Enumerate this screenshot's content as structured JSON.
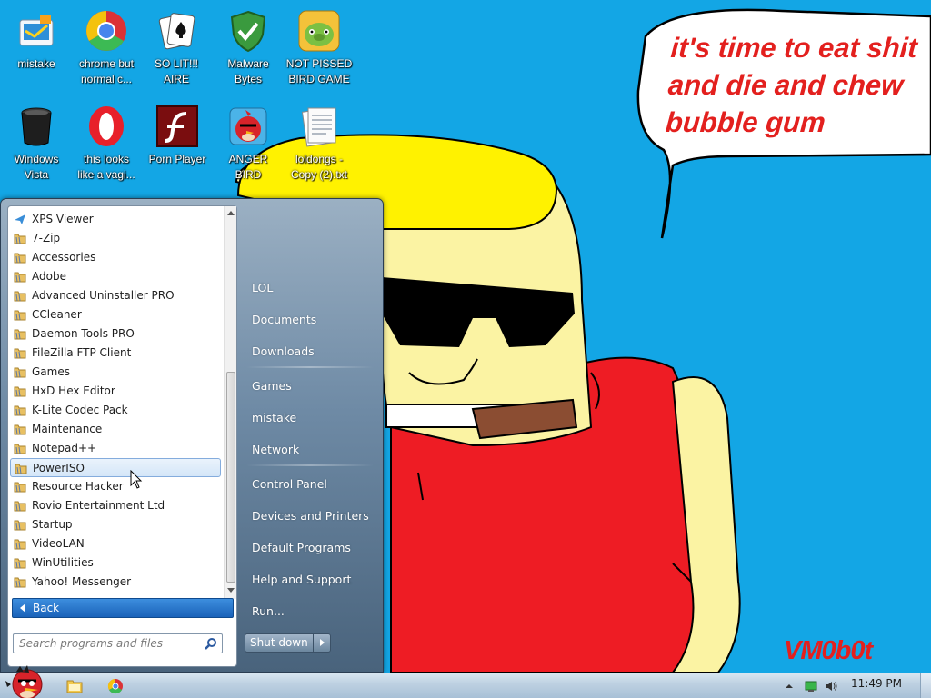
{
  "desktop": {
    "speech_bubble": "it's time to eat shit\nand die and chew\nbubble gum",
    "signature": "VM0b0t",
    "icons": [
      {
        "label": "mistake",
        "icon": "media-center-icon"
      },
      {
        "label": "chrome but\nnormal c...",
        "icon": "chrome-icon"
      },
      {
        "label": "SO LIT!!!\nAIRE",
        "icon": "solitaire-icon"
      },
      {
        "label": "Malware\nBytes",
        "icon": "malwarebytes-shield-icon"
      },
      {
        "label": "NOT PISSED\nBIRD GAME",
        "icon": "bad-piggies-icon"
      },
      {
        "label": "Windows\nVista",
        "icon": "trash-can-icon"
      },
      {
        "label": "this looks\nlike a vagi...",
        "icon": "opera-icon"
      },
      {
        "label": "Porn Player",
        "icon": "flash-player-icon"
      },
      {
        "label": "ANGER\nBIRD",
        "icon": "angry-birds-icon"
      },
      {
        "label": "loldongs -\nCopy (2).txt",
        "icon": "text-file-icon"
      }
    ]
  },
  "start_menu": {
    "programs": [
      "XPS Viewer",
      "7-Zip",
      "Accessories",
      "Adobe",
      "Advanced Uninstaller PRO",
      "CCleaner",
      "Daemon Tools PRO",
      "FileZilla FTP Client",
      "Games",
      "HxD Hex Editor",
      "K-Lite Codec Pack",
      "Maintenance",
      "Notepad++",
      "PowerISO",
      "Resource Hacker",
      "Rovio Entertainment Ltd",
      "Startup",
      "VideoLAN",
      "WinUtilities",
      "Yahoo! Messenger"
    ],
    "highlighted_program": "PowerISO",
    "back_label": "Back",
    "search_placeholder": "Search programs and files",
    "right_items": [
      "LOL",
      "Documents",
      "Downloads",
      "Games",
      "mistake",
      "Network",
      "Control Panel",
      "Devices and Printers",
      "Default Programs",
      "Help and Support",
      "Run..."
    ],
    "shutdown_label": "Shut down"
  },
  "taskbar": {
    "clock": "11:49 PM",
    "pinned": [
      "explorer-folder-icon",
      "chrome-icon"
    ],
    "tray": [
      "show-hidden-icons-icon",
      "network-icon",
      "volume-icon"
    ]
  },
  "colors": {
    "desktop_bg": "#13a6e5",
    "bubble_text": "#e3201e",
    "highlight": "#d4e6f8"
  }
}
